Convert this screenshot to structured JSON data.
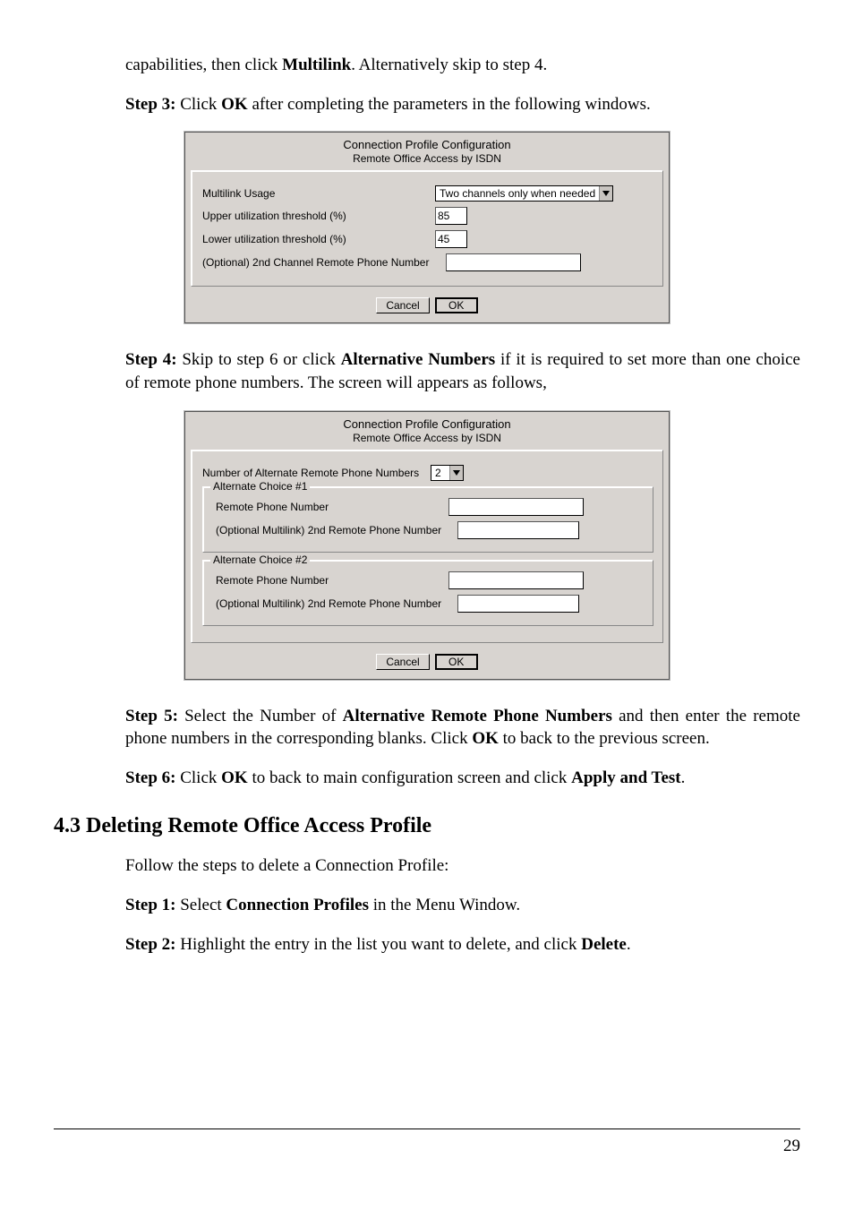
{
  "page_number": "29",
  "intro_line": {
    "pre": "capabilities, then click ",
    "bold": "Multilink",
    "post": ". Alternatively skip to step 4."
  },
  "step3": {
    "label": "Step 3:",
    "pre": " Click ",
    "bold": "OK",
    "post": " after completing the parameters in the following windows."
  },
  "dialog1": {
    "title1": "Connection Profile Configuration",
    "title2": "Remote Office Access by ISDN",
    "rows": {
      "multilink_usage_label": "Multilink Usage",
      "multilink_usage_value": "Two channels only when needed",
      "upper_label": "Upper utilization threshold  (%)",
      "upper_value": "85",
      "lower_label": "Lower utilization threshold  (%)",
      "lower_value": "45",
      "opt_phone_label": "(Optional) 2nd Channel Remote Phone Number",
      "opt_phone_value": ""
    },
    "cancel": "Cancel",
    "ok": "OK"
  },
  "step4": {
    "label": "Step 4:",
    "pre": " Skip to step 6 or click ",
    "bold": "Alternative Numbers",
    "post": " if it is required to set more than one choice of remote phone numbers. The screen will appears as follows,"
  },
  "dialog2": {
    "title1": "Connection Profile Configuration",
    "title2": "Remote Office Access by ISDN",
    "num_label": "Number of Alternate Remote Phone Numbers",
    "num_value": "2",
    "choice1_legend": "Alternate Choice #1",
    "choice2_legend": "Alternate Choice #2",
    "remote_label": "Remote Phone Number",
    "remote_value": "",
    "opt_label": "(Optional Multilink) 2nd Remote Phone Number",
    "opt_value": "",
    "cancel": "Cancel",
    "ok": "OK"
  },
  "step5": {
    "label": "Step 5:",
    "pre": " Select the Number of ",
    "bold1": "Alternative Remote Phone Numbers",
    "mid": " and then enter the remote phone numbers in the corresponding blanks. Click ",
    "bold2": "OK",
    "post": " to back to the previous screen."
  },
  "step6": {
    "label": "Step 6:",
    "pre": " Click ",
    "bold1": "OK",
    "mid": " to back to main configuration screen and click ",
    "bold2": "Apply and Test",
    "post": "."
  },
  "section_heading": "4.3 Deleting Remote Office Access Profile",
  "delete_intro": "Follow the steps to delete a Connection Profile:",
  "dstep1": {
    "label": "Step 1:",
    "pre": " Select ",
    "bold": "Connection Profiles",
    "post": " in the Menu Window."
  },
  "dstep2": {
    "label": "Step 2:",
    "pre": " Highlight the entry in the list you want to delete, and click ",
    "bold": "Delete",
    "post": "."
  }
}
